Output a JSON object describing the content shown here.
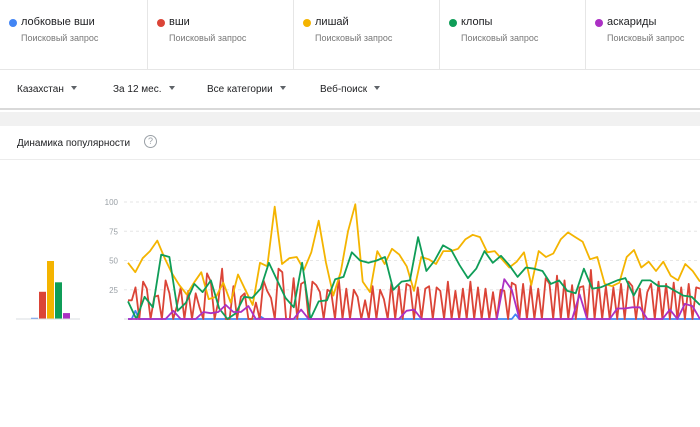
{
  "terms": [
    {
      "name": "лобковые вши",
      "sub": "Поисковый запрос",
      "color": "#4285f4"
    },
    {
      "name": "вши",
      "sub": "Поисковый запрос",
      "color": "#db4437"
    },
    {
      "name": "лишай",
      "sub": "Поисковый запрос",
      "color": "#f4b400"
    },
    {
      "name": "клопы",
      "sub": "Поисковый запрос",
      "color": "#0f9d58"
    },
    {
      "name": "аскариды",
      "sub": "Поисковый запрос",
      "color": "#ab30c4"
    }
  ],
  "filters": {
    "region": "Казахстан",
    "period": "За 12 мес.",
    "category": "Все категории",
    "search_type": "Веб-поиск"
  },
  "card": {
    "title": "Динамика популярности",
    "help_glyph": "?"
  },
  "chart_data": {
    "type": "line",
    "y_ticks": [
      "100",
      "75",
      "50",
      "25"
    ],
    "ylim": [
      0,
      100
    ],
    "averages": [
      1,
      23,
      49,
      31,
      5
    ],
    "series": [
      {
        "name": "лобковые вши",
        "color": "#4285f4",
        "values": [
          0,
          0,
          7,
          0,
          0,
          0,
          0,
          0,
          0,
          0,
          0,
          0,
          0,
          0,
          0,
          0,
          0,
          0,
          0,
          0,
          0,
          0,
          0,
          0,
          0,
          0,
          0,
          0,
          0,
          0,
          0,
          0,
          0,
          0,
          0,
          0,
          2,
          0,
          0,
          0,
          0,
          0,
          0,
          0,
          0,
          0,
          0,
          0,
          0,
          0,
          0,
          0,
          0,
          0,
          0,
          0,
          0,
          0,
          0,
          0,
          0,
          0,
          0,
          0,
          0,
          0,
          0,
          0,
          0,
          0,
          0,
          0,
          0,
          0,
          0,
          0,
          0,
          0,
          0,
          0,
          0,
          0,
          0,
          0,
          0,
          0,
          0,
          0,
          0,
          0,
          0,
          0,
          0,
          0,
          0,
          0,
          0,
          0,
          0,
          0,
          0,
          0,
          0,
          0,
          0,
          4,
          0,
          0,
          0,
          0,
          0,
          0,
          0,
          0,
          0,
          0,
          0,
          0,
          0,
          0,
          0,
          0,
          0,
          0,
          0,
          0,
          0,
          0,
          0,
          0,
          0,
          0,
          0,
          0,
          0,
          0,
          0,
          0,
          0,
          0,
          0,
          0,
          0,
          0,
          0,
          0,
          0,
          0,
          0,
          0,
          0,
          0,
          0,
          0,
          0,
          0
        ]
      },
      {
        "name": "вши",
        "color": "#db4437",
        "values": [
          16,
          16,
          27,
          0,
          32,
          26,
          0,
          19,
          20,
          0,
          33,
          22,
          0,
          11,
          27,
          0,
          24,
          0,
          22,
          10,
          0,
          39,
          32,
          0,
          15,
          43,
          0,
          0,
          28,
          0,
          19,
          22,
          0,
          0,
          14,
          0,
          33,
          24,
          18,
          0,
          43,
          40,
          0,
          0,
          35,
          0,
          30,
          32,
          0,
          32,
          29,
          23,
          0,
          25,
          23,
          0,
          35,
          0,
          26,
          0,
          25,
          19,
          0,
          16,
          0,
          28,
          0,
          25,
          17,
          0,
          31,
          0,
          28,
          0,
          30,
          28,
          0,
          27,
          0,
          26,
          28,
          0,
          27,
          24,
          0,
          32,
          0,
          24,
          0,
          26,
          0,
          32,
          0,
          27,
          0,
          26,
          0,
          23,
          0,
          25,
          24,
          0,
          31,
          29,
          0,
          30,
          0,
          29,
          0,
          26,
          0,
          35,
          30,
          0,
          37,
          0,
          33,
          0,
          29,
          0,
          27,
          28,
          0,
          42,
          0,
          32,
          0,
          28,
          0,
          27,
          0,
          30,
          0,
          32,
          28,
          0,
          26,
          0,
          23,
          30,
          0,
          32,
          0,
          30,
          0,
          31,
          0,
          27,
          0,
          30,
          0,
          27,
          26
        ]
      },
      {
        "name": "лишай",
        "color": "#f4b400",
        "values": [
          48,
          40,
          52,
          58,
          67,
          52,
          39,
          29,
          21,
          31,
          40,
          17,
          19,
          31,
          14,
          38,
          25,
          12,
          48,
          45,
          96,
          47,
          52,
          53,
          42,
          57,
          84,
          48,
          20,
          40,
          75,
          98,
          32,
          23,
          58,
          47,
          60,
          55,
          45,
          24,
          53,
          51,
          47,
          58,
          58,
          60,
          68,
          72,
          70,
          57,
          58,
          51,
          44,
          49,
          57,
          29,
          58,
          53,
          56,
          68,
          74,
          70,
          66,
          51,
          53,
          30,
          28,
          31,
          53,
          59,
          44,
          49,
          41,
          49,
          37,
          33,
          47,
          41,
          32
        ]
      },
      {
        "name": "клопы",
        "color": "#0f9d58",
        "values": [
          15,
          0,
          19,
          10,
          55,
          53,
          7,
          14,
          30,
          23,
          33,
          9,
          0,
          5,
          19,
          18,
          26,
          48,
          33,
          18,
          10,
          48,
          0,
          15,
          16,
          34,
          36,
          57,
          50,
          48,
          50,
          53,
          25,
          32,
          33,
          70,
          41,
          50,
          63,
          59,
          46,
          35,
          43,
          58,
          48,
          54,
          46,
          36,
          44,
          43,
          41,
          30,
          33,
          24,
          22,
          43,
          26,
          27,
          30,
          33,
          35,
          20,
          33,
          33,
          28,
          28,
          24,
          20,
          19,
          12
        ]
      },
      {
        "name": "аскариды",
        "color": "#ab30c4",
        "values": [
          0,
          0,
          0,
          0,
          0,
          0,
          7,
          0,
          0,
          0,
          6,
          5,
          6,
          12,
          6,
          6,
          11,
          0,
          0,
          0,
          0,
          0,
          0,
          8,
          0,
          0,
          0,
          0,
          0,
          0,
          0,
          0,
          0,
          0,
          0,
          0,
          0,
          7,
          8,
          0,
          0,
          0,
          0,
          0,
          0,
          0,
          0,
          0,
          0,
          0,
          34,
          25,
          0,
          0,
          0,
          0,
          0,
          0,
          0,
          0,
          21,
          0,
          0,
          0,
          0,
          9,
          9,
          10,
          10,
          0,
          0,
          0,
          8,
          0,
          13,
          11,
          0
        ]
      }
    ]
  }
}
